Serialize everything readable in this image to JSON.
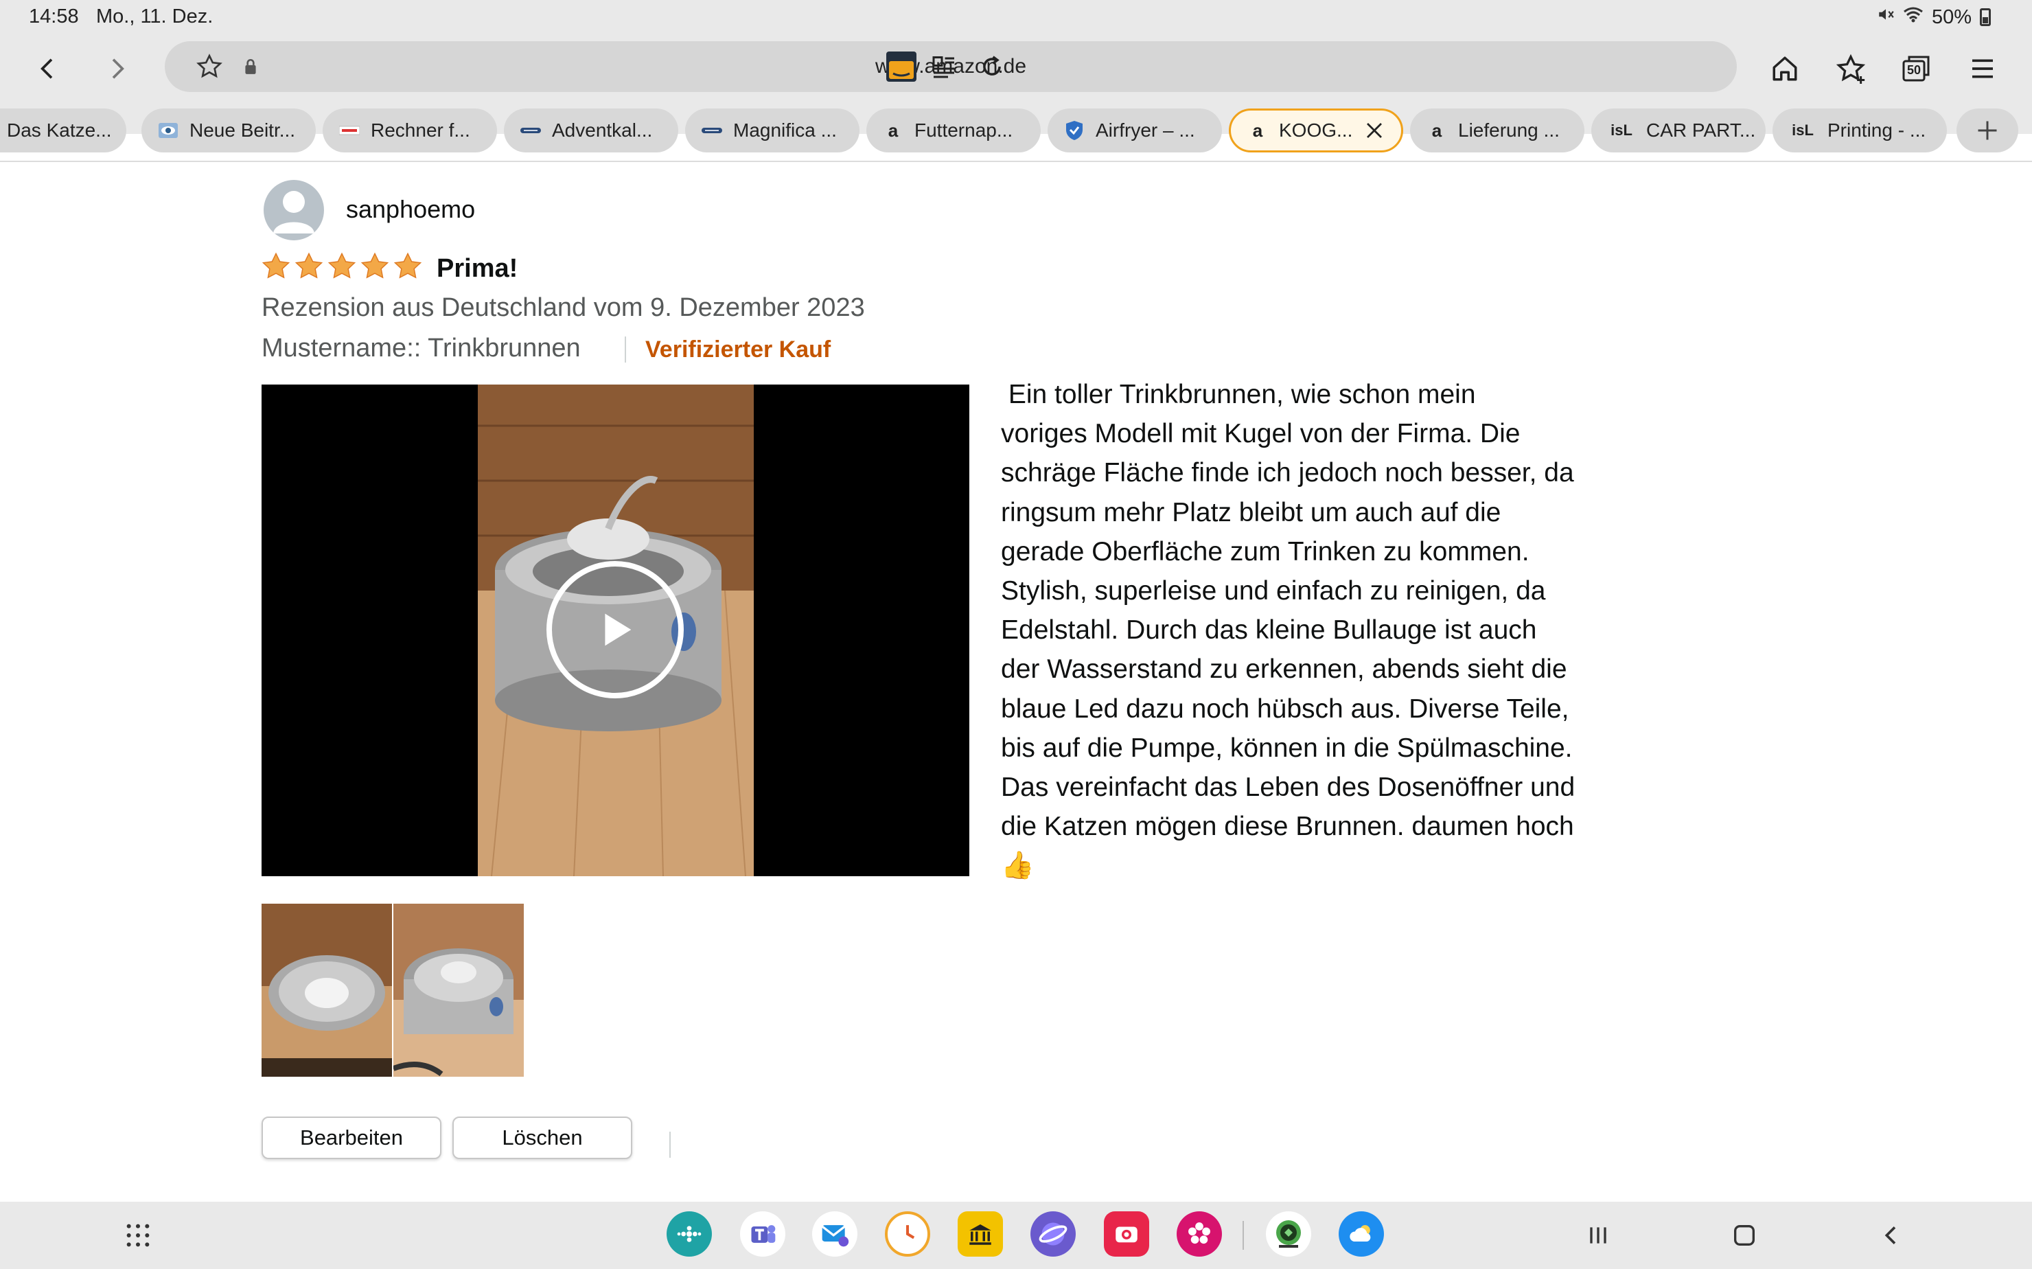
{
  "status": {
    "time": "14:58",
    "date": "Mo., 11. Dez.",
    "battery": "50%"
  },
  "browser": {
    "url": "www.amazon.de",
    "tabs_count": "50",
    "tabs": [
      {
        "label": "Das Katze...",
        "favicon": ""
      },
      {
        "label": "Neue Beitr...",
        "favicon": "eye"
      },
      {
        "label": "Rechner f...",
        "favicon": "site"
      },
      {
        "label": "Adventkal...",
        "favicon": "dash"
      },
      {
        "label": "Magnifica ...",
        "favicon": "dash"
      },
      {
        "label": "Futternap...",
        "favicon": "a"
      },
      {
        "label": "Airfryer – ...",
        "favicon": "shield"
      },
      {
        "label": "KOOG...",
        "favicon": "a"
      },
      {
        "label": "Lieferung ...",
        "favicon": "a"
      },
      {
        "label": "CAR PART...",
        "favicon": "isl"
      },
      {
        "label": "Printing - ...",
        "favicon": "isl"
      }
    ],
    "favicon_text": {
      "a": "a",
      "isl": "isL"
    }
  },
  "review": {
    "reviewer": "sanphoemo",
    "rating": 5,
    "title": "Prima!",
    "meta": "Rezension aus Deutschland vom 9. Dezember 2023",
    "variant": "Mustername:: Trinkbrunnen",
    "verified": "Verifizierter Kauf",
    "body": " Ein toller Trinkbrunnen, wie schon mein\nvoriges Modell mit Kugel von der Firma. Die\nschräge Fläche finde ich jedoch noch besser, da\nringsum mehr Platz bleibt um auch auf die\ngerade Oberfläche zum Trinken zu kommen.\nStylish, superleise und einfach zu reinigen, da\nEdelstahl. Durch das kleine Bullauge ist auch\nder Wasserstand zu erkennen, abends sieht die\nblaue Led dazu noch hübsch aus. Diverse Teile,\nbis auf die Pumpe, können in die Spülmaschine.\nDas vereinfacht das Leben des Dosenöffner und\ndie Katzen mögen diese Brunnen. daumen hoch\n👍",
    "edit_label": "Bearbeiten",
    "delete_label": "Löschen"
  },
  "colors": {
    "star": "#f3a847",
    "verified": "#c45500",
    "active_tab_border": "#f0a21b"
  }
}
